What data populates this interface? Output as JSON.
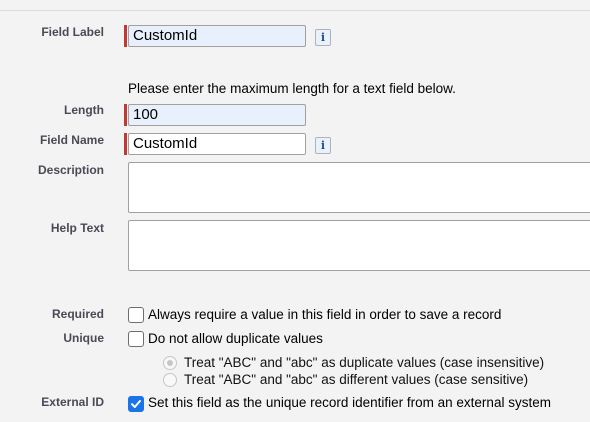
{
  "fields": {
    "field_label": {
      "label": "Field Label",
      "value": "CustomId",
      "info_glyph": "i"
    },
    "length_hint": "Please enter the maximum length for a text field below.",
    "length": {
      "label": "Length",
      "value": "100"
    },
    "field_name": {
      "label": "Field Name",
      "value": "CustomId",
      "info_glyph": "i"
    },
    "description": {
      "label": "Description",
      "value": ""
    },
    "help_text": {
      "label": "Help Text",
      "value": ""
    }
  },
  "options": {
    "required": {
      "label": "Required",
      "text": "Always require a value in this field in order to save a record",
      "checked": false
    },
    "unique": {
      "label": "Unique",
      "text": "Do not allow duplicate values",
      "checked": false
    },
    "case_insensitive": {
      "text": "Treat \"ABC\" and \"abc\" as duplicate values (case insensitive)",
      "selected": true,
      "disabled": true
    },
    "case_sensitive": {
      "text": "Treat \"ABC\" and \"abc\" as different values (case sensitive)",
      "selected": false,
      "disabled": true
    },
    "external_id": {
      "label": "External ID",
      "text": "Set this field as the unique record identifier from an external system",
      "checked": true
    }
  },
  "colors": {
    "required_marker": "#c23934",
    "checkbox_checked": "#1a73e8",
    "label_text": "#4a4a56"
  }
}
